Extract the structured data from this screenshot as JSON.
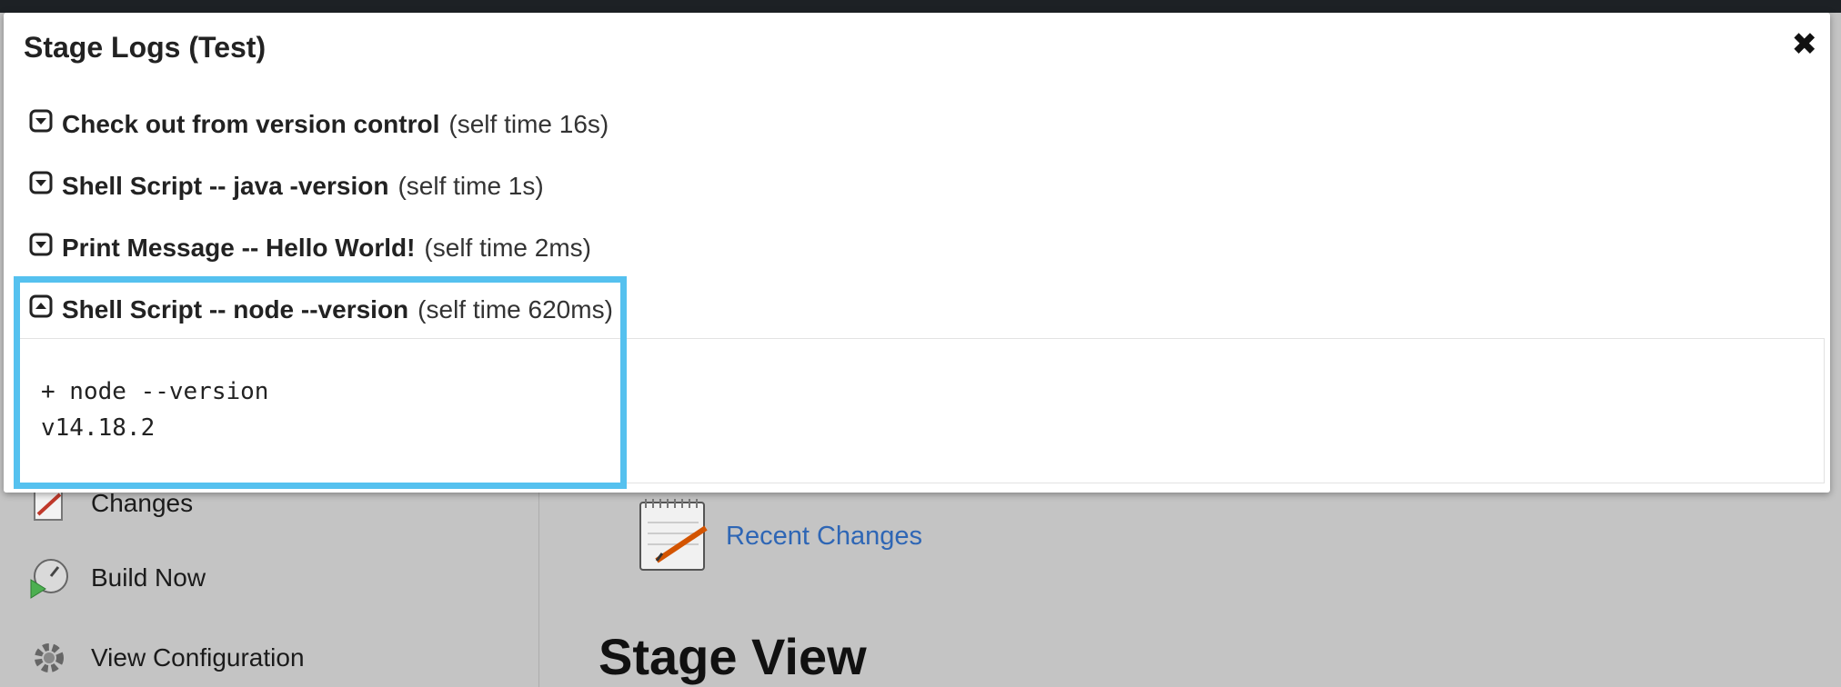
{
  "modal": {
    "title": "Stage Logs (Test)",
    "close_icon": "close-icon",
    "steps": [
      {
        "name": "Check out from version control",
        "time": "(self time 16s)",
        "icon": "chevron-down-icon",
        "expanded": false
      },
      {
        "name": "Shell Script -- java -version",
        "time": "(self time 1s)",
        "icon": "chevron-down-icon",
        "expanded": false
      },
      {
        "name": "Print Message -- Hello World!",
        "time": "(self time 2ms)",
        "icon": "chevron-down-icon",
        "expanded": false
      },
      {
        "name": "Shell Script -- node --version",
        "time": "(self time 620ms)",
        "icon": "chevron-up-icon",
        "expanded": true
      }
    ],
    "log_output": "+ node --version\nv14.18.2"
  },
  "sidebar": {
    "items": [
      {
        "label": "Changes",
        "icon": "notepad-icon"
      },
      {
        "label": "Build Now",
        "icon": "build-now-icon"
      },
      {
        "label": "View Configuration",
        "icon": "gear-icon"
      }
    ]
  },
  "main": {
    "recent_changes_label": "Recent Changes",
    "stage_view_heading": "Stage View"
  },
  "colors": {
    "highlight": "#55c1ef",
    "link": "#2e66b5",
    "overlay_bg": "#c4c4c4"
  }
}
